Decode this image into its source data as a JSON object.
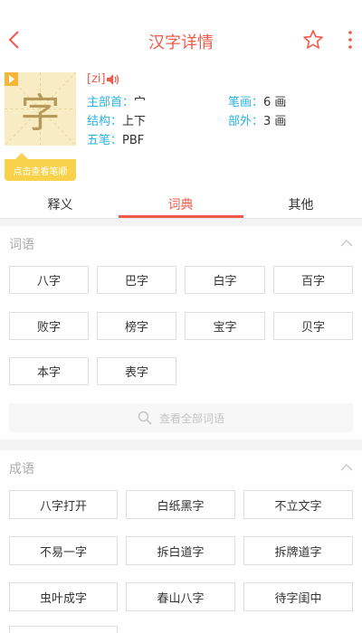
{
  "header": {
    "title": "汉字详情"
  },
  "character": {
    "glyph": "字",
    "pinyin": "[zi]",
    "stroke_order_button": "点击查看笔顺",
    "radical_label": "主部首：",
    "radical_value": "宀",
    "strokes_label": "笔画：",
    "strokes_value": "6 画",
    "structure_label": "结构：",
    "structure_value": "上下",
    "outside_label": "部外：",
    "outside_value": "3 画",
    "wubi_label": "五笔：",
    "wubi_value": "PBF"
  },
  "tabs": [
    "释义",
    "词典",
    "其他"
  ],
  "active_tab": 1,
  "words": {
    "title": "词语",
    "items": [
      "八字",
      "巴字",
      "白字",
      "百字",
      "败字",
      "榜字",
      "宝字",
      "贝字",
      "本字",
      "表字"
    ],
    "view_all": "查看全部词语"
  },
  "idioms": {
    "title": "成语",
    "items": [
      "八字打开",
      "白纸黑字",
      "不立文字",
      "不易一字",
      "拆白道字",
      "拆牌道字",
      "虫叶成字",
      "春山八字",
      "待字闺中"
    ]
  },
  "colors": {
    "accent": "#ef5a4a",
    "label_blue": "#2ab3e0",
    "card_yellow": "#f8d24a"
  },
  "icons": [
    "back-arrow-icon",
    "star-icon",
    "more-vertical-icon",
    "play-icon",
    "speaker-icon",
    "chevron-up-icon",
    "search-icon"
  ]
}
